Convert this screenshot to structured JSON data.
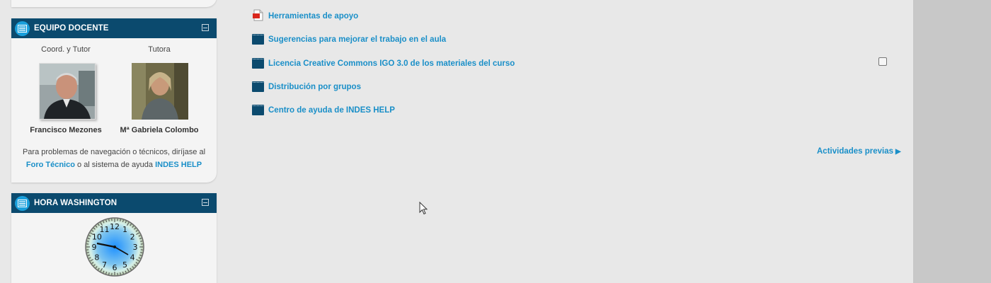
{
  "teachers_block": {
    "title": "EQUIPO DOCENTE",
    "teachers": [
      {
        "role": "Coord. y Tutor",
        "name": "Francisco Mezones"
      },
      {
        "role": "Tutora",
        "name": "Mª Gabriela Colombo"
      }
    ],
    "help_prefix": "Para problemas de navegación o técnicos, diríjase al",
    "forum_link": "Foro Técnico",
    "help_middle": "o al sistema de ayuda",
    "help_link": "INDES HELP"
  },
  "clock_block": {
    "title": "HORA WASHINGTON",
    "numbers": [
      "12",
      "1",
      "2",
      "3",
      "4",
      "5",
      "6",
      "7",
      "8",
      "9",
      "10",
      "11"
    ]
  },
  "resources": [
    {
      "label": "Herramientas de apoyo",
      "icon": "pdf-icon"
    },
    {
      "label": "Sugerencias para mejorar el trabajo en el aula",
      "icon": "folder-icon"
    },
    {
      "label": "Licencia Creative Commons IGO 3.0 de los materiales del curso",
      "icon": "folder-icon"
    },
    {
      "label": "Distribución por grupos",
      "icon": "folder-icon"
    },
    {
      "label": "Centro de ayuda de INDES HELP",
      "icon": "folder-icon"
    }
  ],
  "navigation": {
    "previous_activities": "Actividades previas",
    "arrow": "▶"
  },
  "colors": {
    "header_bg": "#0b4a6e",
    "link": "#1a8fc8",
    "icon_circle": "#1aa0dc"
  }
}
